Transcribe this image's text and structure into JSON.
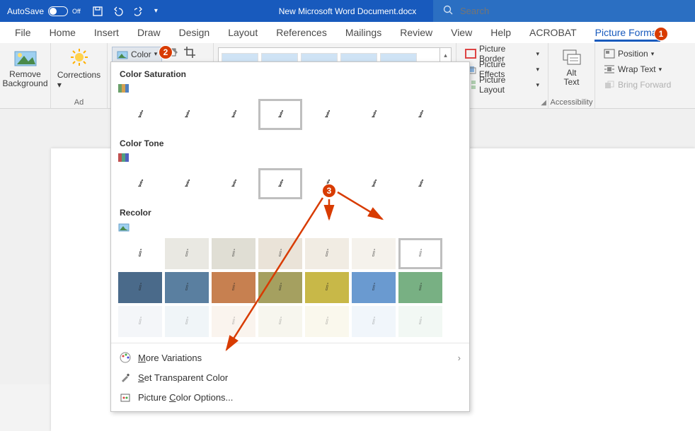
{
  "titlebar": {
    "autosave_label": "AutoSave",
    "autosave_state": "Off",
    "doc_title": "New Microsoft Word Document.docx"
  },
  "search": {
    "placeholder": "Search"
  },
  "tabs": [
    "File",
    "Home",
    "Insert",
    "Draw",
    "Design",
    "Layout",
    "References",
    "Mailings",
    "Review",
    "View",
    "Help",
    "ACROBAT",
    "Picture Format"
  ],
  "ribbon": {
    "remove_bg": "Remove\nBackground",
    "corrections": "Corrections",
    "color": "Color",
    "crop": "",
    "adjust_label": "Ad",
    "border": "Picture Border",
    "effects": "Picture Effects",
    "layout": "Picture Layout",
    "styles_label": "",
    "alt_text": "Alt\nText",
    "accessibility_label": "Accessibility",
    "position": "Position",
    "wrap": "Wrap Text",
    "forward": "Bring Forward"
  },
  "dropdown": {
    "saturation_title": "Color Saturation",
    "tone_title": "Color Tone",
    "recolor_title": "Recolor",
    "more_variations": "ore Variations",
    "more_variations_prefix": "M",
    "set_transparent": "et Transparent Color",
    "set_transparent_prefix": "S",
    "picture_color_options": "olor Options...",
    "picture_color_prefix": "Picture ",
    "picture_color_c": "C",
    "recolor_colors": [
      [
        "#ffffff",
        "#e9e8e2",
        "#e0ded4",
        "#eae3d8",
        "#f1ece3",
        "#f5f2ec",
        "#ffffff"
      ],
      [
        "#4a6a8a",
        "#5a7fa0",
        "#c78050",
        "#a5a060",
        "#c8b848",
        "#6a9ad0",
        "#78b083"
      ],
      [
        "#f4f6f9",
        "#f0f5f8",
        "#faf4ee",
        "#f7f6ee",
        "#faf8ed",
        "#f1f6fb",
        "#f2f8f4"
      ]
    ]
  },
  "callouts": {
    "c1": "1",
    "c2": "2",
    "c3": "3"
  }
}
